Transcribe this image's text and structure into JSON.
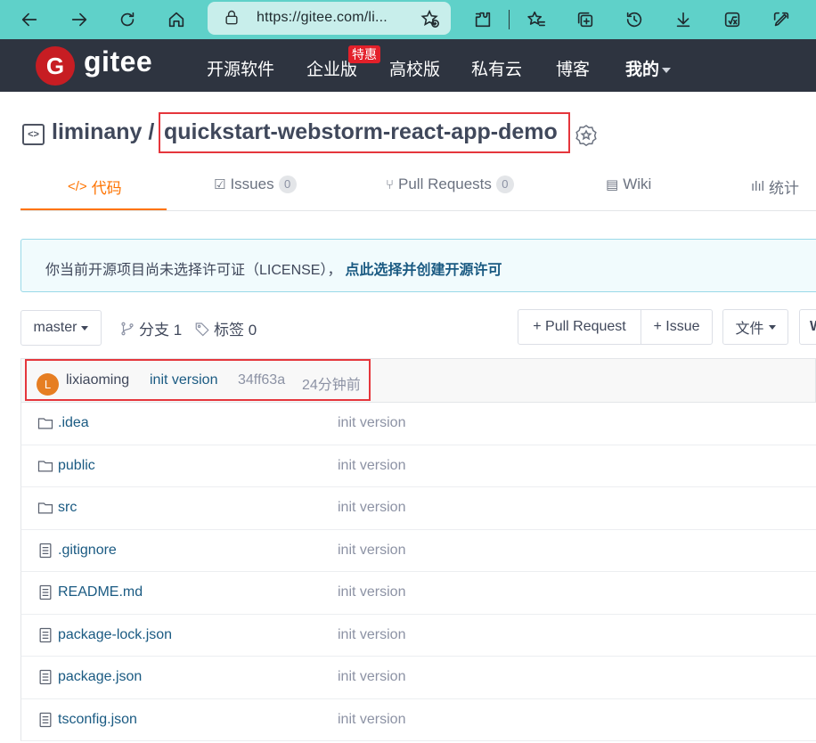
{
  "browser": {
    "url": "https://gitee.com/li..."
  },
  "header": {
    "logo_text": "gitee",
    "logo_mark": "G",
    "nav": [
      "开源软件",
      "企业版",
      "高校版",
      "私有云",
      "博客",
      "我的"
    ],
    "hot_badge": "特惠",
    "colors": {
      "bar": "#2e3440",
      "brand": "#c71d23",
      "browser_bar": "#5fd1c9"
    }
  },
  "repo": {
    "owner": "liminany /",
    "name": "quickstart-webstorm-react-app-demo"
  },
  "tabs": [
    {
      "label": "代码",
      "icon": "code-icon"
    },
    {
      "label": "Issues",
      "count": "0",
      "icon": "issues-icon"
    },
    {
      "label": "Pull Requests",
      "count": "0",
      "icon": "pull-request-icon"
    },
    {
      "label": "Wiki",
      "icon": "wiki-icon"
    },
    {
      "label": "统计",
      "icon": "stats-icon"
    }
  ],
  "notice": {
    "text": "你当前开源项目尚未选择许可证（LICENSE），",
    "link": "点此选择并创建开源许可"
  },
  "toolbar": {
    "branch": "master",
    "branches": "分支 1",
    "tags": "标签 0",
    "pull_request": "+ Pull Request",
    "issue": "+ Issue",
    "files": "文件",
    "clone_partial": "W"
  },
  "commit": {
    "avatar_letter": "L",
    "author": "lixiaoming",
    "message": "init version",
    "hash": "34ff63a",
    "time": "24分钟前"
  },
  "files": [
    {
      "name": ".idea",
      "type": "folder",
      "message": "init version"
    },
    {
      "name": "public",
      "type": "folder",
      "message": "init version"
    },
    {
      "name": "src",
      "type": "folder",
      "message": "init version"
    },
    {
      "name": ".gitignore",
      "type": "file",
      "message": "init version"
    },
    {
      "name": "README.md",
      "type": "file",
      "message": "init version"
    },
    {
      "name": "package-lock.json",
      "type": "file",
      "message": "init version"
    },
    {
      "name": "package.json",
      "type": "file",
      "message": "init version"
    },
    {
      "name": "tsconfig.json",
      "type": "file",
      "message": "init version"
    }
  ]
}
